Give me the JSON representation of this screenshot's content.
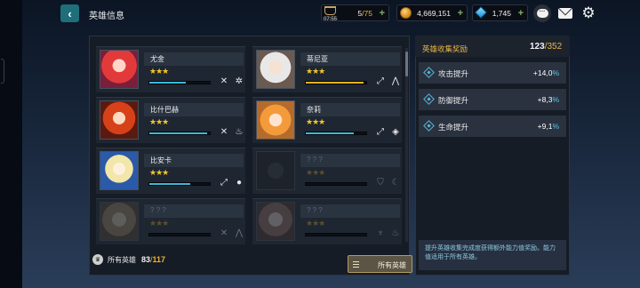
{
  "header": {
    "title": "英雄信息",
    "stamina": {
      "value": "5",
      "max": "75",
      "timer": "07:55"
    },
    "gold": "4,669,151",
    "gems": "1,745"
  },
  "heroes": [
    {
      "name": "尤金",
      "stars": "★★★",
      "progress": 0.6,
      "bar_color": "#3fb7d9",
      "locked": false,
      "icons": [
        "sword-icon",
        "gear-icon"
      ]
    },
    {
      "name": "蒂尼亚",
      "stars": "★★★",
      "progress": 0.95,
      "bar_color": "#f2b318",
      "locked": false,
      "icons": [
        "bow-icon",
        "mountain-icon"
      ]
    },
    {
      "name": "比什巴赫",
      "stars": "★★★",
      "progress": 0.95,
      "bar_color": "#3fb7d9",
      "locked": false,
      "icons": [
        "sword-icon",
        "fire-icon"
      ]
    },
    {
      "name": "奈莉",
      "stars": "★★★",
      "progress": 0.8,
      "bar_color": "#3fb7d9",
      "locked": false,
      "icons": [
        "bow-icon",
        "diamond-icon"
      ]
    },
    {
      "name": "比安卡",
      "stars": "★★★",
      "progress": 0.68,
      "bar_color": "#3fb7d9",
      "locked": false,
      "icons": [
        "bow-icon",
        "water-icon"
      ]
    },
    {
      "name": "? ? ?",
      "stars": "★★★",
      "progress": 0,
      "bar_color": "#3fb7d9",
      "locked": true,
      "icons": [
        "shield-icon",
        "moon-icon"
      ]
    },
    {
      "name": "? ? ?",
      "stars": "★★★",
      "progress": 0,
      "bar_color": "#3fb7d9",
      "locked": true,
      "icons": [
        "sword-icon",
        "mountain-icon"
      ]
    },
    {
      "name": "? ? ?",
      "stars": "★★★",
      "progress": 0,
      "bar_color": "#3fb7d9",
      "locked": true,
      "icons": [
        "axe-icon",
        "fire-icon"
      ]
    }
  ],
  "collection": {
    "label": "所有英雄",
    "owned": "83",
    "separator": "/",
    "total": "117"
  },
  "filter": {
    "label": "所有英雄"
  },
  "rewards": {
    "title": "英雄收集奖励",
    "current": "123",
    "separator": "/",
    "total": "352",
    "bonuses": [
      {
        "label": "攻击提升",
        "value": "+14,0",
        "unit": "%"
      },
      {
        "label": "防御提升",
        "value": "+8,3",
        "unit": "%"
      },
      {
        "label": "生命提升",
        "value": "+9,1",
        "unit": "%"
      }
    ],
    "note": "提升英雄收集完成度获得额外能力值奖励。能力值适用于所有英雄。"
  },
  "colors": {
    "accent_gold": "#e6b54a",
    "accent_cyan": "#5ec7e8",
    "panel_bg": "#161c25"
  }
}
